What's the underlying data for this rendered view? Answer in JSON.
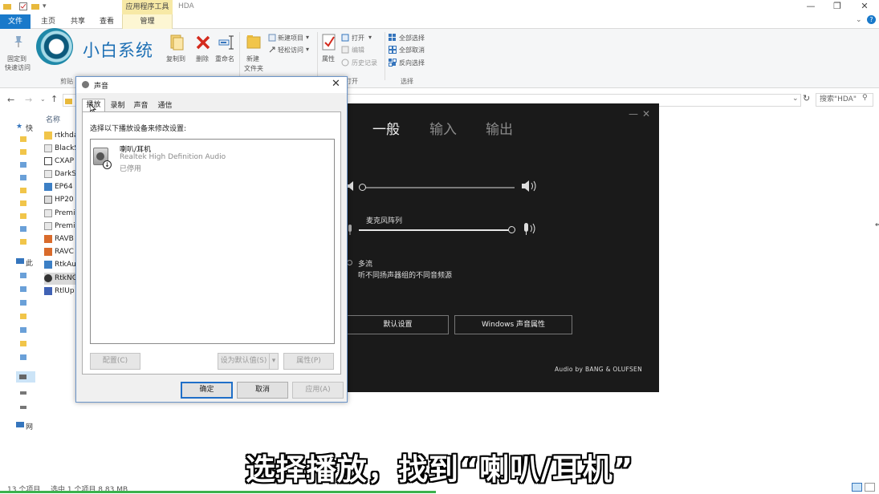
{
  "explorer": {
    "window_title": "HDA",
    "context_header": "应用程序工具",
    "tabs": {
      "file": "文件",
      "home": "主页",
      "share": "共享",
      "view": "查看",
      "manage": "管理"
    },
    "ribbon": {
      "pin_label_1": "固定到",
      "pin_label_2": "快速访问",
      "copy_path": "复制到",
      "delete": "删除",
      "rename": "重命名",
      "new_folder_1": "新建",
      "new_folder_2": "文件夹",
      "new_item": "新建项目",
      "easy_access": "轻松访问",
      "properties": "属性",
      "open": "打开",
      "edit": "编辑",
      "history": "历史记录",
      "select_all": "全部选择",
      "select_none": "全部取消",
      "invert": "反向选择",
      "group_clipboard": "剪贴",
      "group_open": "打开",
      "group_select": "选择"
    },
    "logo_text": "小白系统",
    "search_placeholder": "搜索\"HDA\"",
    "column_name": "名称",
    "nav": {
      "quick": "快",
      "this_pc": "此",
      "network": "网"
    },
    "files": [
      "rtkhda",
      "BlackS",
      "CXAP",
      "DarkS",
      "EP64",
      "HP20",
      "Premi",
      "Premi",
      "RAVB",
      "RAVC",
      "RtkAu",
      "RtkNG",
      "RtlUp"
    ],
    "status_count": "13 个项目",
    "status_selected": "选中 1 个项目 8.83 MB"
  },
  "audio_console": {
    "tabs": [
      "一般",
      "输入",
      "输出"
    ],
    "mic_array_label": "麦克风阵列",
    "multistream_label": "多流",
    "multistream_desc": "听不同扬声器组的不同音频源",
    "default_settings_btn": "默认设置",
    "windows_sound_btn": "Windows 声音属性",
    "brand": "Audio by BANG & OLUFSEN",
    "output_volume": 0,
    "mic_volume": 1.0
  },
  "sound_dialog": {
    "title": "声音",
    "tabs": [
      "播放",
      "录制",
      "声音",
      "通信"
    ],
    "instruction": "选择以下播放设备来修改设置:",
    "device": {
      "name": "喇叭/耳机",
      "driver": "Realtek High Definition Audio",
      "status": "已停用"
    },
    "btn_configure": "配置(C)",
    "btn_set_default": "设为默认值(S)",
    "btn_properties": "属性(P)",
    "btn_ok": "确定",
    "btn_cancel": "取消",
    "btn_apply": "应用(A)"
  },
  "subtitle": "选择播放，找到“喇叭/耳机”",
  "colors": {
    "accent": "#1979ca",
    "progress": "#3bb24d",
    "console_bg": "#1a1a1a"
  }
}
